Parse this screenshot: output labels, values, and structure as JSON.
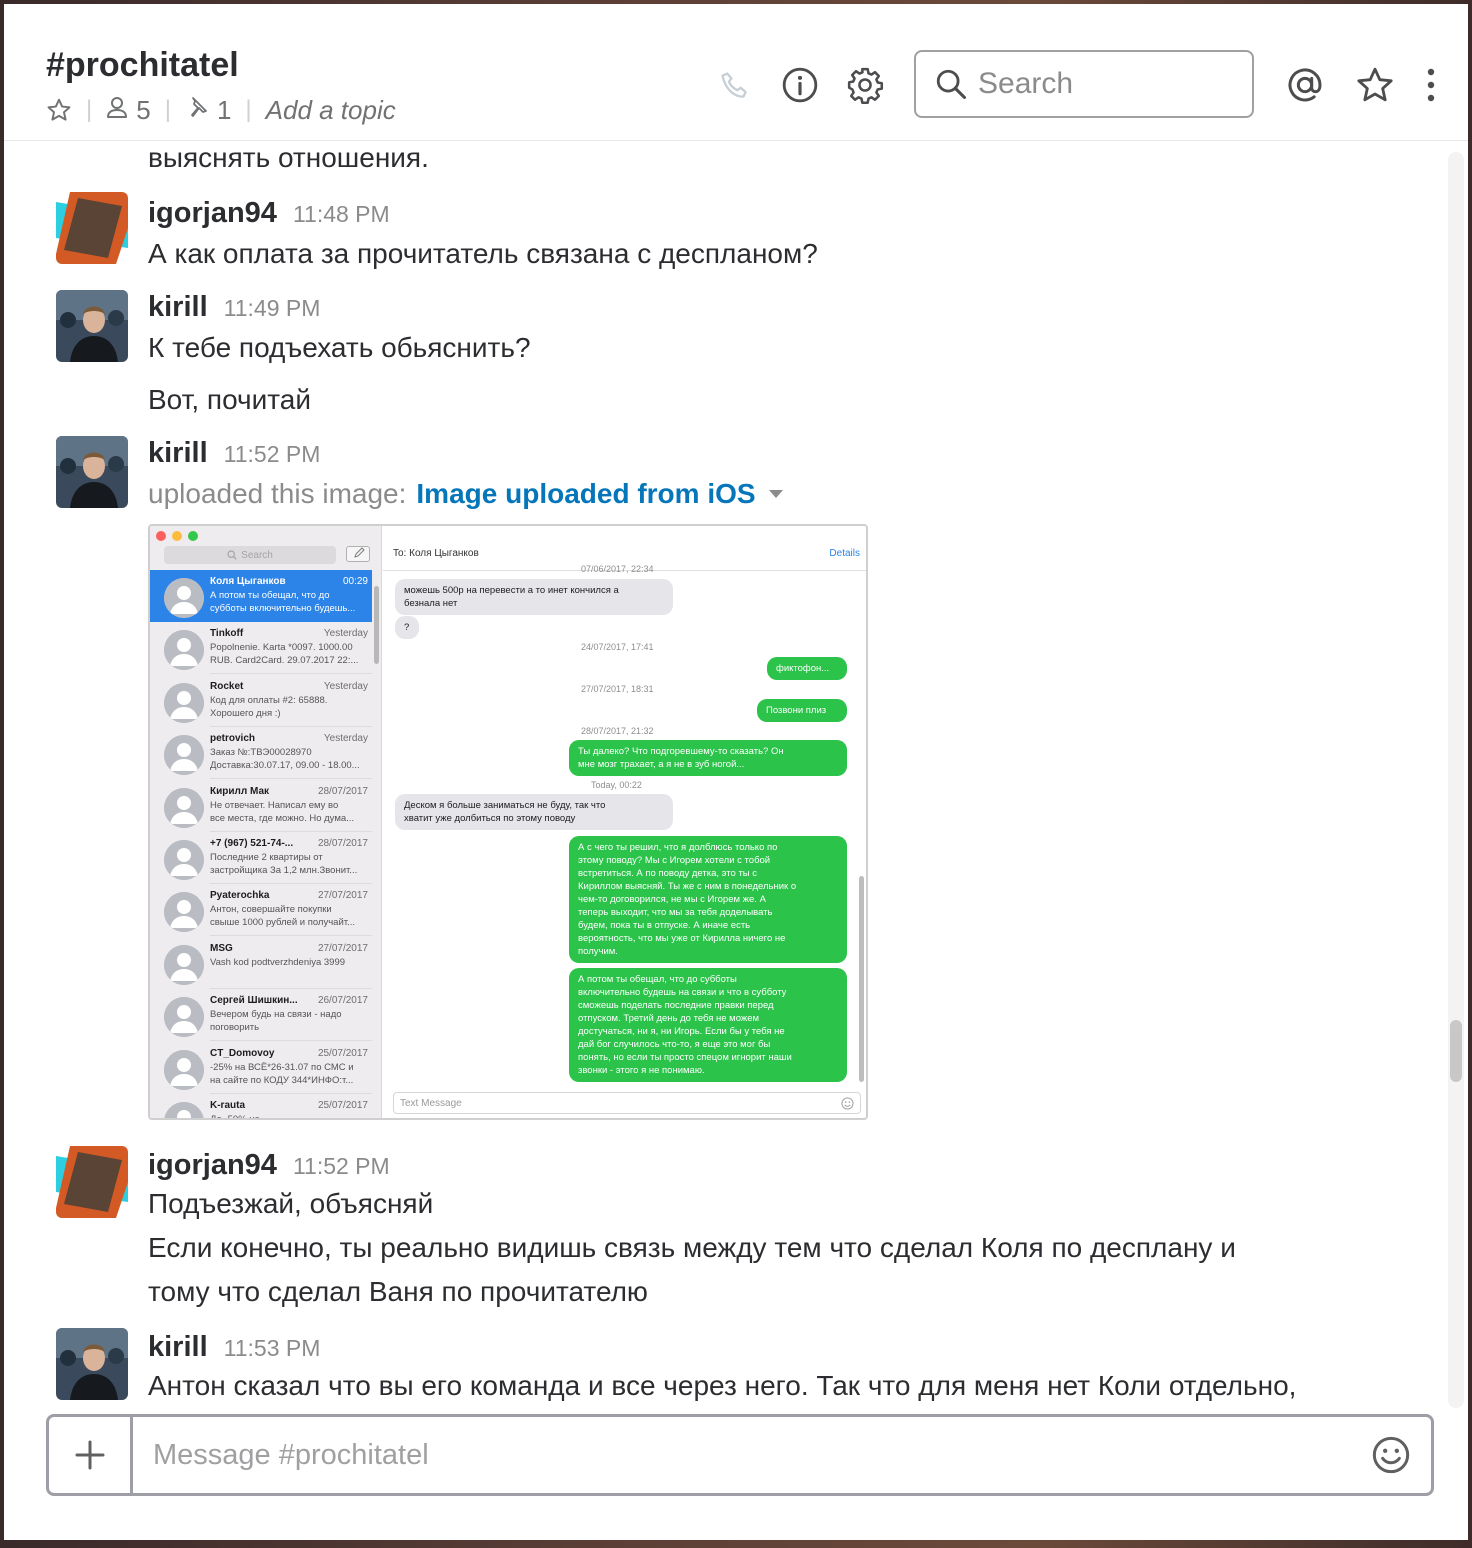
{
  "header": {
    "channel": "#prochitatel",
    "members_count": "5",
    "pins_count": "1",
    "topic_placeholder": "Add a topic",
    "search_placeholder": "Search"
  },
  "messages": {
    "cut_line": "выяснять отношения.",
    "m1": {
      "author": "igorjan94",
      "time": "11:48 PM",
      "text": "А как оплата за прочитатель связана с деспланом?"
    },
    "m2": {
      "author": "kirill",
      "time": "11:49 PM",
      "text": "К тебе подъехать обьяснить?",
      "text2": "Вот, почитай"
    },
    "m3": {
      "author": "kirill",
      "time": "11:52 PM",
      "upload_prefix": "uploaded this image:",
      "upload_link": "Image uploaded from iOS"
    },
    "m4": {
      "author": "igorjan94",
      "time": "11:52 PM",
      "text": "Подъезжай, объясняй",
      "text2": "Если конечно, ты реально видишь связь между тем что сделал Коля по десплану и",
      "text3": "тому что сделал Ваня по прочитателю"
    },
    "m5": {
      "author": "kirill",
      "time": "11:53 PM",
      "text": "Антон сказал что вы его команда и все через него. Так что для меня нет Коли отдельно,"
    }
  },
  "embedded": {
    "search": "Search",
    "to": "To:  Коля Цыганков",
    "details": "Details",
    "input_placeholder": "Text Message",
    "conversations": [
      {
        "name": "Коля Цыганков",
        "date": "00:29",
        "preview": "А потом ты обещал, что до\nсубботы включительно будешь..."
      },
      {
        "name": "Tinkoff",
        "date": "Yesterday",
        "preview": "Popolnenie. Karta *0097. 1000.00\nRUB. Card2Card. 29.07.2017 22:..."
      },
      {
        "name": "Rocket",
        "date": "Yesterday",
        "preview": "Код для оплаты #2: 65888.\nХорошего дня :)"
      },
      {
        "name": "petrovich",
        "date": "Yesterday",
        "preview": "Заказ №:ТВЭ00028970\nДоставка:30.07.17, 09.00 - 18.00..."
      },
      {
        "name": "Кирилл Мак",
        "date": "28/07/2017",
        "preview": "Не отвечает. Написал ему во\nвсе места, где можно. Но дума..."
      },
      {
        "name": "+7 (967) 521-74-...",
        "date": "28/07/2017",
        "preview": "Последние 2 квартиры от\nзастройщика За 1,2 млн.Звонит..."
      },
      {
        "name": "Pyaterochka",
        "date": "27/07/2017",
        "preview": "Антон, совершайте покупки\nсвыше 1000 рублей и получайт..."
      },
      {
        "name": "MSG",
        "date": "27/07/2017",
        "preview": "Vash kod podtverzhdeniya 3999"
      },
      {
        "name": "Сергей Шишкин...",
        "date": "26/07/2017",
        "preview": "Вечером будь на связи - надо\nпоговорить"
      },
      {
        "name": "CT_Domovoy",
        "date": "25/07/2017",
        "preview": "-25% на ВСЁ*26-31.07 по СМС и\nна сайте по КОДУ 344*ИНФО:т..."
      },
      {
        "name": "K-rauta",
        "date": "25/07/2017",
        "preview": "До -50% на"
      }
    ],
    "chat": {
      "stamp0": "07/06/2017, 22:34",
      "in1": "можешь 500р на перевести а то инет кончился а\nбезнала нет",
      "in2": "?",
      "stamp1": "24/07/2017, 17:41",
      "out1": "фиктофон...",
      "stamp2": "27/07/2017, 18:31",
      "out2": "Позвони плиз",
      "stamp3": "28/07/2017, 21:32",
      "out3": "Ты далеко? Что подгоревшему-то сказать? Он\nмне мозг трахает, а я не в зуб ногой...",
      "stamp4": "Today, 00:22",
      "in3": "Деском я больше заниматься не буду, так что\nхватит уже долбиться по этому поводу",
      "out4": "А с чего ты решил, что я долблюсь только по\nэтому поводу? Мы с Игорем хотели с тобой\nвстретиться. А по поводу детка, это ты с\nКириллом выясняй. Ты же с ним в понедельник о\nчем-то договорился, не мы с Игорем же. А\nтеперь выходит, что мы за тебя доделывать\nбудем, пока ты в отпуске. А иначе есть\nвероятность, что мы уже от Кирилла ничего не\nполучим.",
      "out5": "А потом ты обещал, что до субботы\nвключительно будешь на связи и что в субботу\nсможешь поделать последние правки перед\nотпуском. Третий день до тебя не можем\nдостучаться, ни я, ни Игорь. Если бы у тебя не\nдай бог случилось что-то, я еще это мог бы\nпонять, но если ты просто спецом игнорит наши\nзвонки - этого я не понимаю."
    }
  },
  "composer": {
    "placeholder": "Message #prochitatel"
  },
  "colors": {
    "link": "#0576b9",
    "imessage_blue": "#2c83e8",
    "imessage_green": "#2bc34a"
  }
}
